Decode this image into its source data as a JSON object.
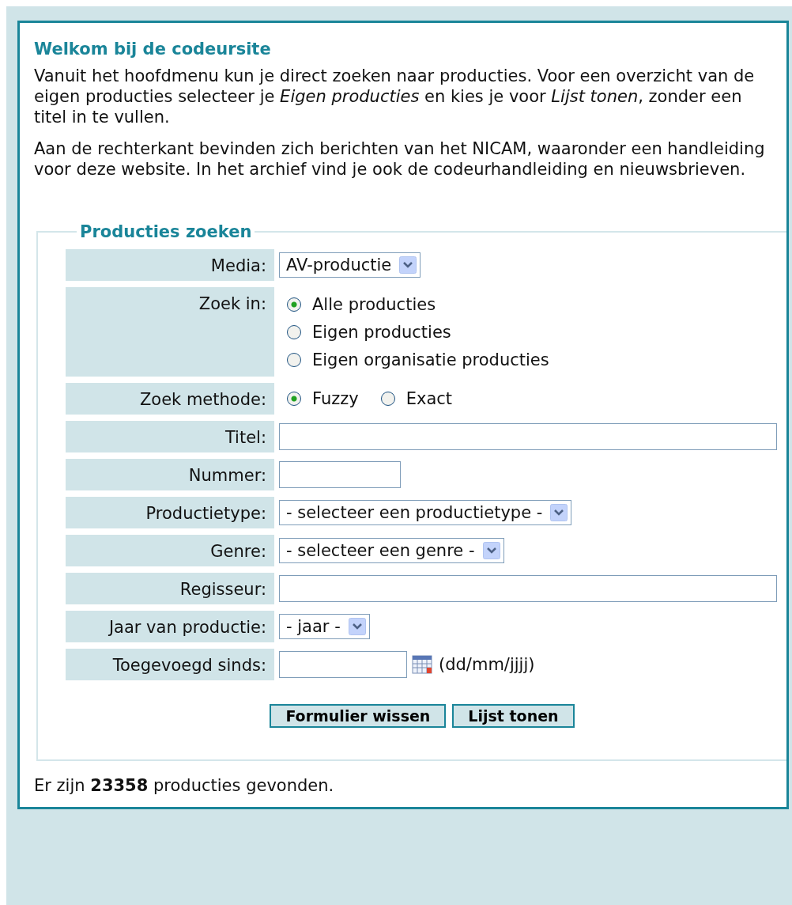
{
  "heading": "Welkom bij de codeursite",
  "intro": [
    "Vanuit het hoofdmenu kun je direct zoeken naar producties. Voor een overzicht van de eigen producties selecteer je *Eigen producties* en kies je voor *Lijst tonen*, zonder een titel in te vullen.",
    "Aan de rechterkant bevinden zich berichten van het NICAM, waaronder een handleiding voor deze website. In het archief vind je ook de codeurhandleiding en nieuwsbrieven."
  ],
  "search_form": {
    "legend": "Producties zoeken",
    "fields": [
      {
        "kind": "select",
        "label": "Media:",
        "value": "AV-productie"
      },
      {
        "kind": "radio-stack",
        "label": "Zoek in:",
        "options": [
          {
            "label": "Alle producties",
            "selected": true
          },
          {
            "label": "Eigen producties",
            "selected": false
          },
          {
            "label": "Eigen organisatie producties",
            "selected": false
          }
        ]
      },
      {
        "kind": "radio-inline",
        "label": "Zoek methode:",
        "options": [
          {
            "label": "Fuzzy",
            "selected": true
          },
          {
            "label": "Exact",
            "selected": false
          }
        ]
      },
      {
        "kind": "text-wide",
        "label": "Titel:"
      },
      {
        "kind": "text-short",
        "label": "Nummer:"
      },
      {
        "kind": "select",
        "label": "Productietype:",
        "value": "- selecteer een productietype -"
      },
      {
        "kind": "select",
        "label": "Genre:",
        "value": "- selecteer een genre -"
      },
      {
        "kind": "text-wide",
        "label": "Regisseur:"
      },
      {
        "kind": "select",
        "label": "Jaar van productie:",
        "value": "- jaar -"
      },
      {
        "kind": "date",
        "label": "Toegevoegd sinds:",
        "hint": "(dd/mm/jjjj)"
      }
    ],
    "buttons": [
      "Formulier wissen",
      "Lijst tonen"
    ]
  },
  "result": "Er zijn **23358** producties gevonden."
}
